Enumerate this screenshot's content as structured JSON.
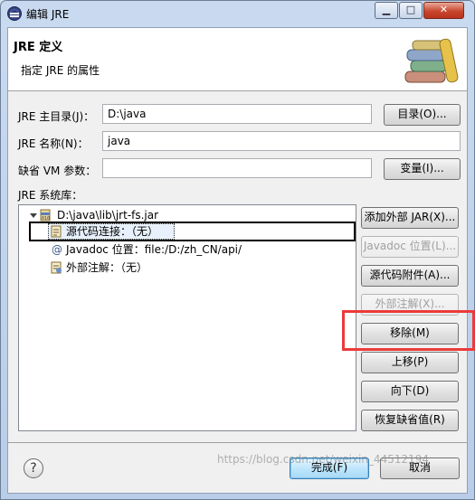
{
  "window": {
    "title": "编辑 JRE",
    "min_glyph": "▁",
    "max_glyph": "□",
    "close_glyph": "✕"
  },
  "banner": {
    "title": "JRE 定义",
    "description": "指定 JRE 的属性"
  },
  "form": {
    "home_label": "JRE 主目录(J)：",
    "home_value": "D:\\java",
    "home_button": "目录(O)...",
    "name_label": "JRE 名称(N)：",
    "name_value": "java",
    "vm_args_label": "缺省 VM 参数：",
    "vm_args_value": "",
    "vm_args_button": "变量(I)...",
    "libs_label": "JRE 系统库："
  },
  "tree": {
    "root": "D:\\java\\lib\\jrt-fs.jar",
    "children": [
      {
        "label": "源代码连接：（无）",
        "icon": "source-attachment-icon"
      },
      {
        "label": "Javadoc 位置：file:/D:/zh_CN/api/",
        "icon": "javadoc-at-icon"
      },
      {
        "label": "外部注解：（无）",
        "icon": "annotation-icon"
      }
    ]
  },
  "side_buttons": [
    {
      "label": "添加外部 JAR(X)...",
      "enabled": true
    },
    {
      "label": "Javadoc 位置(L)...",
      "enabled": false
    },
    {
      "label": "源代码附件(A)...",
      "enabled": true
    },
    {
      "label": "外部注解(X)...",
      "enabled": false
    },
    {
      "label": "移除(M)",
      "enabled": true
    },
    {
      "label": "上移(P)",
      "enabled": true
    },
    {
      "label": "向下(D)",
      "enabled": true
    },
    {
      "label": "恢复缺省值(R)",
      "enabled": true
    }
  ],
  "footer": {
    "help_glyph": "?",
    "finish_button": "完成(F)",
    "cancel_button": "取消"
  },
  "watermark": "https://blog.csdn.net/weixin_44512194",
  "colors": {
    "highlight_red": "#ec3a3a",
    "selection_bg": "#e8f1fb"
  }
}
